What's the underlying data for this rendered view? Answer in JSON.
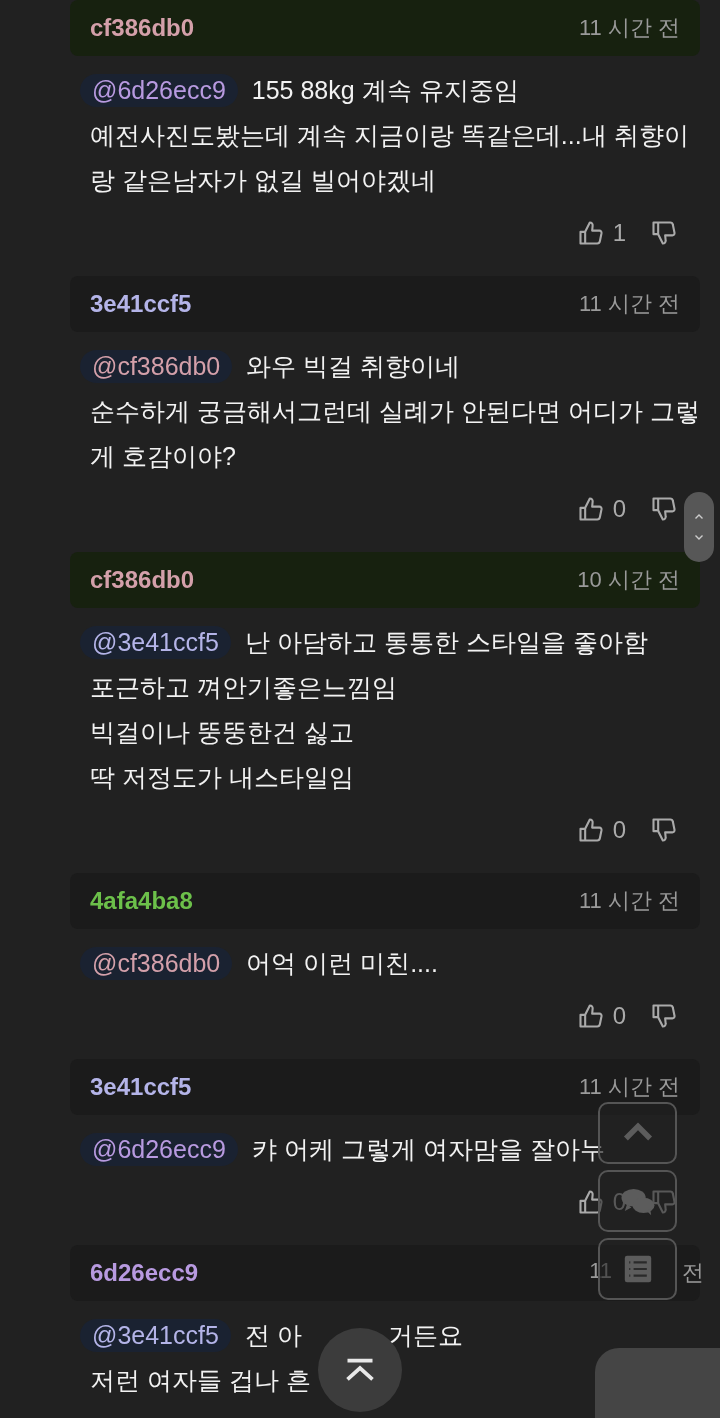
{
  "comments": [
    {
      "author": "cf386db0",
      "color": "#d4a0aa",
      "highlighted": true,
      "time": "11 시간 전",
      "mention": {
        "name": "@6d26ecc9",
        "color": "#b89ae0"
      },
      "lines": [
        [
          "155 88kg 계속 유지중임"
        ],
        [
          "예전사진도봤는데 계속 지금이랑 똑같은데...내 취향이"
        ],
        [
          "랑 같은남자가 없길 빌어야겠네"
        ]
      ],
      "likes": "1"
    },
    {
      "author": "3e41ccf5",
      "color": "#b4b4e8",
      "highlighted": false,
      "time": "11 시간 전",
      "mention": {
        "name": "@cf386db0",
        "color": "#d4a0aa"
      },
      "lines": [
        [
          "와우 빅걸 취향이네"
        ],
        [
          "순수하게 궁금해서그런데 실례가 안된다면 어디가 그렇"
        ],
        [
          "게 호감이야?"
        ]
      ],
      "likes": "0"
    },
    {
      "author": "cf386db0",
      "color": "#d4a0aa",
      "highlighted": true,
      "time": "10 시간 전",
      "mention": {
        "name": "@3e41ccf5",
        "color": "#b4b4e8"
      },
      "lines": [
        [
          "난 아담하고 통통한 스타일을 좋아함"
        ],
        [
          "포근하고 껴안기좋은느낌임"
        ],
        [
          "빅걸이나 뚱뚱한건 싫고"
        ],
        [
          "딱 저정도가 내스타일임"
        ]
      ],
      "likes": "0"
    },
    {
      "author": "4afa4ba8",
      "color": "#6cc04a",
      "highlighted": false,
      "time": "11 시간 전",
      "mention": {
        "name": "@cf386db0",
        "color": "#d4a0aa"
      },
      "lines": [
        [
          "어억 이런 미친...."
        ]
      ],
      "likes": "0"
    },
    {
      "author": "3e41ccf5",
      "color": "#b4b4e8",
      "highlighted": false,
      "time": "11 시간 전",
      "mention": {
        "name": "@6d26ecc9",
        "color": "#b89ae0"
      },
      "lines": [
        [
          "캬 어케 그렇게 여자맘을 잘아누"
        ]
      ],
      "likes": "0"
    },
    {
      "author": "6d26ecc9",
      "color": "#b89ae0",
      "highlighted": false,
      "time": "11",
      "time_tail": "전",
      "mention": {
        "name": "@3e41ccf5",
        "color": "#b4b4e8"
      },
      "lines": [
        [
          "전 아",
          "거든요"
        ],
        [
          "저런 여자들 겁나 흔"
        ]
      ]
    }
  ]
}
